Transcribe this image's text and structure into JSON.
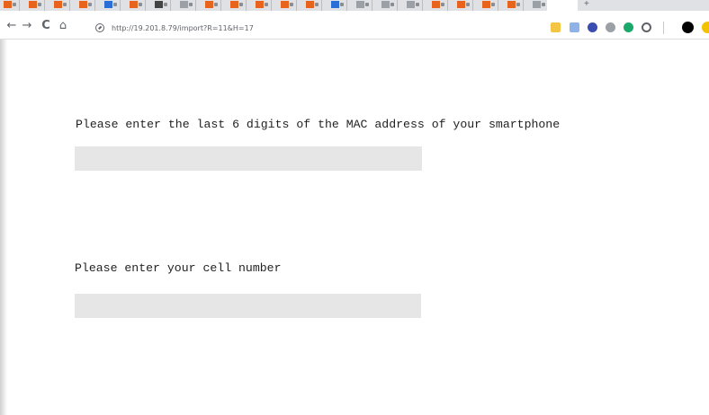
{
  "browser": {
    "url": "http://19.201.8.79/import?R=11&H=17",
    "tabs_count": 22,
    "new_tab_label": "+",
    "nav": {
      "back_icon": "←",
      "forward_icon": "→",
      "reload_icon": "C",
      "home_icon": "⌂"
    },
    "extension_icons": [
      {
        "name": "folder-extension-icon",
        "color": "#f4c542"
      },
      {
        "name": "document-extension-icon",
        "color": "#8fb3e8"
      },
      {
        "name": "blue-dot-extension-icon",
        "color": "#3a4db0"
      },
      {
        "name": "grid-extension-icon",
        "color": "#9aa0a6"
      },
      {
        "name": "green-circle-extension-icon",
        "color": "#1aa86b"
      },
      {
        "name": "circle-outline-extension-icon",
        "color": "#ffffff"
      },
      {
        "name": "black-circle-extension-icon",
        "color": "#000000"
      },
      {
        "name": "yellow-circle-extension-icon",
        "color": "#f2c200"
      }
    ]
  },
  "form": {
    "mac_prompt": "Please enter the last 6 digits of the MAC address of your smartphone",
    "mac_value": "",
    "cell_prompt": "Please enter your cell number",
    "cell_value": ""
  },
  "colors": {
    "input_bg": "#e6e6e6",
    "text": "#222222",
    "tab_strip": "#dfe1e5",
    "tab_favicon_orange": "#e8641c"
  }
}
